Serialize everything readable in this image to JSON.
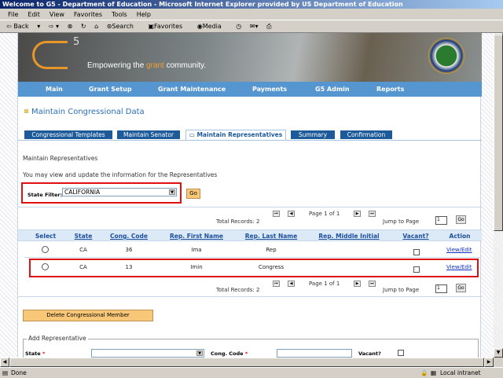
{
  "window": {
    "title": "Welcome to G5 - Department of Education - Microsoft Internet Explorer provided by US Department of Education"
  },
  "menu": [
    "File",
    "Edit",
    "View",
    "Favorites",
    "Tools",
    "Help"
  ],
  "toolbar": {
    "back": "Back",
    "search": "Search",
    "favorites": "Favorites",
    "media": "Media"
  },
  "banner": {
    "logo_sup": "5",
    "tagline_pre": "Empowering the ",
    "tagline_accent": "grant",
    "tagline_post": " community."
  },
  "nav": [
    "Main",
    "Grant Setup",
    "Grant Maintenance",
    "Payments",
    "G5 Admin",
    "Reports"
  ],
  "page_title": "Maintain Congressional Data",
  "tabs": [
    {
      "label": "Congressional Templates"
    },
    {
      "label": "Maintain Senator"
    },
    {
      "label": "Maintain Representatives",
      "active": true
    },
    {
      "label": "Summary"
    },
    {
      "label": "Confirmation"
    }
  ],
  "section_title": "Maintain Representatives",
  "description": "You may view and update the information for the Representatives",
  "filter": {
    "label": "State Filter:",
    "value": "CALIFORNIA",
    "go": "Go"
  },
  "pager": {
    "total": "Total Records: 2",
    "page": "Page 1 of 1",
    "jump_label": "Jump to Page",
    "jump_value": "1",
    "go": "Go"
  },
  "table": {
    "headers": [
      "Select",
      "State",
      "Cong. Code",
      "Rep. First Name",
      "Rep. Last Name",
      "Rep. Middle Initial",
      "Vacant?",
      "Action"
    ],
    "rows": [
      {
        "state": "CA",
        "code": "36",
        "first": "Ima",
        "last": "Rep",
        "middle": "",
        "vacant": false,
        "action": "View/Edit"
      },
      {
        "state": "CA",
        "code": "13",
        "first": "Imin",
        "last": "Congress",
        "middle": "",
        "vacant": false,
        "action": "View/Edit",
        "highlighted": true
      }
    ]
  },
  "delete_button": "Delete Congressional Member",
  "add_form": {
    "legend": "Add Representative",
    "state_label": "State",
    "code_label": "Cong. Code",
    "vacant_label": "Vacant?",
    "required": "*"
  },
  "status": {
    "text": "Done",
    "zone": "Local intranet"
  },
  "colors": {
    "nav": "#5595d0",
    "tab": "#1d5a9a",
    "highlight": "#e01010",
    "button": "#f8c878"
  }
}
